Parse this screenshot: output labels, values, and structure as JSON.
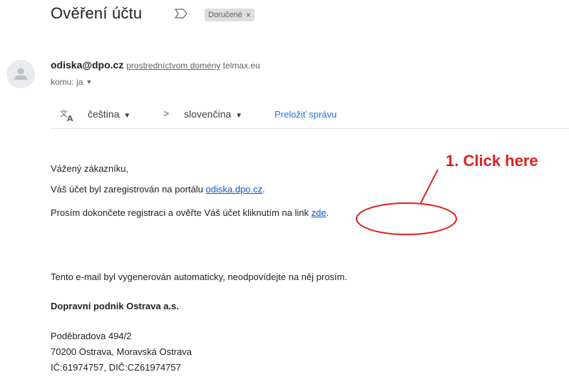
{
  "email": {
    "subject": "Ověření účtu",
    "label_chip": "Doručené",
    "label_chip_close": "×",
    "sender": {
      "email": "odiska@dpo.cz",
      "via_text": "prostredníctvom domény",
      "via_domain": "telmax.eu"
    },
    "recipient": "komu: ja",
    "translate": {
      "from_lang": "čeština",
      "separator": ">",
      "to_lang": "slovenčina",
      "action_label": "Preložiť správu"
    },
    "body": {
      "greeting": "Vážený zákazníku,",
      "line2_prefix": "Váš účet byl zaregistrován na portálu ",
      "line2_link": "odiska.dpo.cz",
      "line2_suffix": ".",
      "line3_prefix": "Prosím dokončete registraci a ověřte Váš účet kliknutím na link ",
      "line3_link": "zde",
      "line3_suffix": ".",
      "auto_notice": "Tento e-mail byl vygenerován automaticky, neodpovídejte na něj prosím.",
      "company": "Dopravní podnik Ostrava a.s.",
      "address1": "Poděbradova 494/2",
      "address2": "70200 Ostrava, Moravská Ostrava",
      "ids": "IČ:61974757, DIČ:CZ61974757"
    }
  },
  "annotation": {
    "text": "1. Click here",
    "color": "#e02020"
  },
  "icons": [
    "important-marker-icon",
    "avatar-person-icon",
    "dropdown-caret-icon",
    "translate-icon"
  ],
  "colors": {
    "link": "#1155cc",
    "translate_link": "#1a73e8",
    "chip_bg": "#dddddd"
  }
}
